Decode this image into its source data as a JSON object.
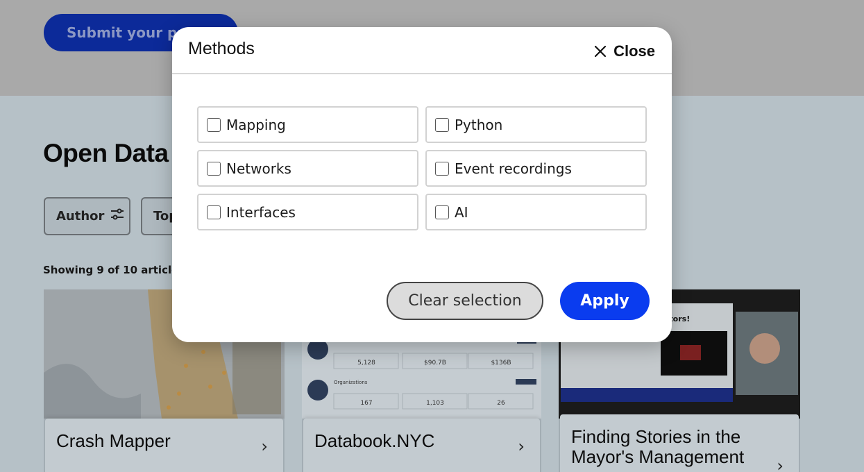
{
  "page": {
    "submit_label": "Submit your pr",
    "title": "Open Data",
    "filters": {
      "author": "Author",
      "topic": "Top"
    },
    "showing": "Showing 9 of 10 articles"
  },
  "cards": [
    {
      "title": "Crash Mapper"
    },
    {
      "title": "Databook.NYC",
      "stats": [
        "5,128",
        "$90.7B",
        "$136B",
        "167",
        "1,103",
        "26"
      ],
      "section_label": "Organizations"
    },
    {
      "title": "Finding Stories in the Mayor's Management",
      "slide_text": "ators!"
    }
  ],
  "modal": {
    "title": "Methods",
    "close_label": "Close",
    "options": [
      {
        "label": "Mapping",
        "checked": false
      },
      {
        "label": "Python",
        "checked": false
      },
      {
        "label": "Networks",
        "checked": false
      },
      {
        "label": "Event recordings",
        "checked": false
      },
      {
        "label": "Interfaces",
        "checked": false
      },
      {
        "label": "AI",
        "checked": false
      }
    ],
    "clear_label": "Clear selection",
    "apply_label": "Apply"
  },
  "colors": {
    "primary": "#0a3cef",
    "modal_bg": "#ffffff",
    "backdrop": "#b6c1c7"
  }
}
